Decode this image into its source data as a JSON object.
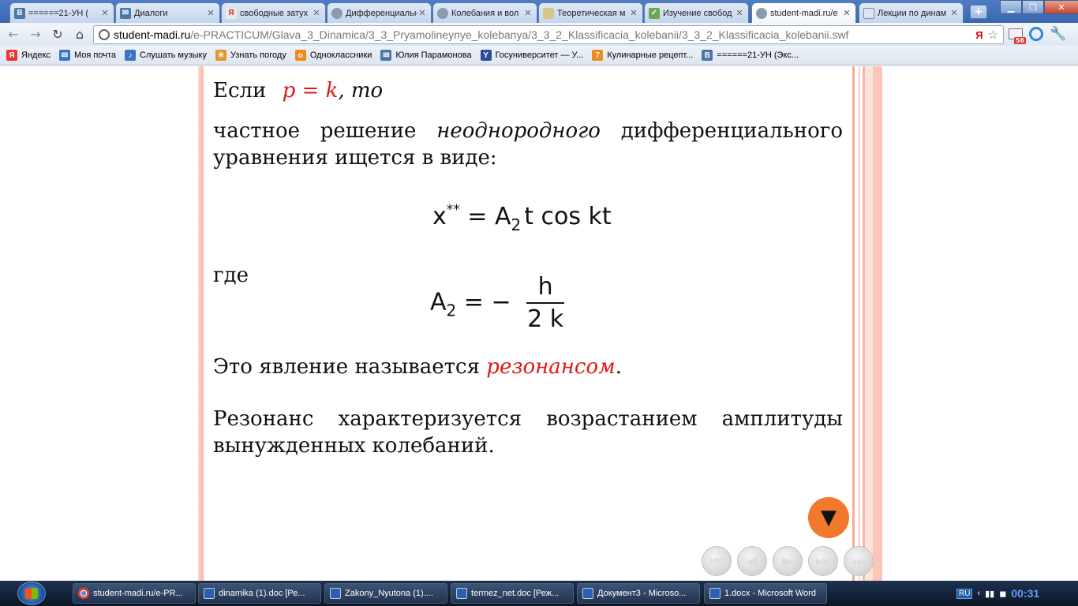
{
  "tabs": [
    {
      "label": "======21-УН (",
      "fav": "В",
      "fav_color": "#4a76a8"
    },
    {
      "label": "Диалоги",
      "fav": "✉",
      "fav_color": "#4a76a8"
    },
    {
      "label": "свободные затух",
      "fav": "Я",
      "fav_color": "#e8e8e8"
    },
    {
      "label": "Дифференциальн",
      "fav": "",
      "fav_color": "#8a9bb0"
    },
    {
      "label": "Колебания и вол",
      "fav": "",
      "fav_color": "#8a9bb0"
    },
    {
      "label": "Теоретическая м",
      "fav": "",
      "fav_color": "#d9c58c"
    },
    {
      "label": "Изучение свобод",
      "fav": "✓",
      "fav_color": "#6aa84f"
    },
    {
      "label": "student-madi.ru/e",
      "fav": "",
      "fav_color": "#8a9bb0"
    },
    {
      "label": "Лекции по динам",
      "fav": "",
      "fav_color": "#dfe6f1"
    }
  ],
  "toolbar": {
    "url_host": "student-madi.ru",
    "url_path": "/e-PRACTICUM/Glava_3_Dinamica/3_3_Pryamolineynye_kolebanya/3_3_2_Klassificacia_kolebanii/3_3_2_Klassificacia_kolebanii.swf",
    "yandex_mark": "Я",
    "mail_count": "56"
  },
  "bookmarks": [
    {
      "label": "Яндекс",
      "fav": "Я",
      "color": "#e33"
    },
    {
      "label": "Моя почта",
      "fav": "✉",
      "color": "#3a73c5"
    },
    {
      "label": "Слушать музыку",
      "fav": "♪",
      "color": "#3a73c5"
    },
    {
      "label": "Узнать погоду",
      "fav": "☀",
      "color": "#e6952e"
    },
    {
      "label": "Одноклассники",
      "fav": "о",
      "color": "#f18b1e"
    },
    {
      "label": "Юлия Парамонова",
      "fav": "✉",
      "color": "#4a76a8"
    },
    {
      "label": "Госуниверситет — У...",
      "fav": "Y",
      "color": "#2b4e9a"
    },
    {
      "label": "Кулинарные рецепт...",
      "fav": "7",
      "color": "#f08a1c"
    },
    {
      "label": "======21-УН (Экс...",
      "fav": "В",
      "color": "#4a76a8"
    }
  ],
  "slide": {
    "if_word": "Если",
    "condition": "p = k",
    "then_word": ", то",
    "line2_words": [
      "частное",
      "решение",
      "неоднородного",
      "дифференциального"
    ],
    "line2_italic_index": 2,
    "line3": "уравнения ищется в виде:",
    "formula1_lhs": "x",
    "formula1_sup": "**",
    "formula1_eq": " = A",
    "formula1_sub": "2",
    "formula1_rhs": "t cos kt",
    "where_word": "где",
    "formula2_lhs": "A",
    "formula2_sub": "2",
    "formula2_eq": " = −",
    "formula2_num": "h",
    "formula2_den": "2 k",
    "phenomenon_prefix": "Это явление называется ",
    "phenomenon_term": "резонансом",
    "phenomenon_suffix": ".",
    "resonance_line1_words": [
      "Резонанс",
      "характеризуется",
      "возрастанием",
      "амплитуды"
    ],
    "resonance_line2": "вынужденных колебаний."
  },
  "player": {
    "down_symbol": "▼",
    "buttons": [
      "⏮",
      "◀",
      "▶",
      "▶▶",
      "⏭"
    ]
  },
  "taskbar": {
    "items": [
      {
        "label": "student-madi.ru/e-PR...",
        "kind": "chrome"
      },
      {
        "label": "dinamika (1).doc [Ре...",
        "kind": "word"
      },
      {
        "label": "Zakony_Nyutona (1)....",
        "kind": "word"
      },
      {
        "label": "termez_net.doc [Реж...",
        "kind": "word"
      },
      {
        "label": "Документ3 - Microso...",
        "kind": "word"
      },
      {
        "label": "1.docx - Microsoft Word",
        "kind": "word"
      }
    ],
    "lang": "RU",
    "clock": "00:31"
  }
}
